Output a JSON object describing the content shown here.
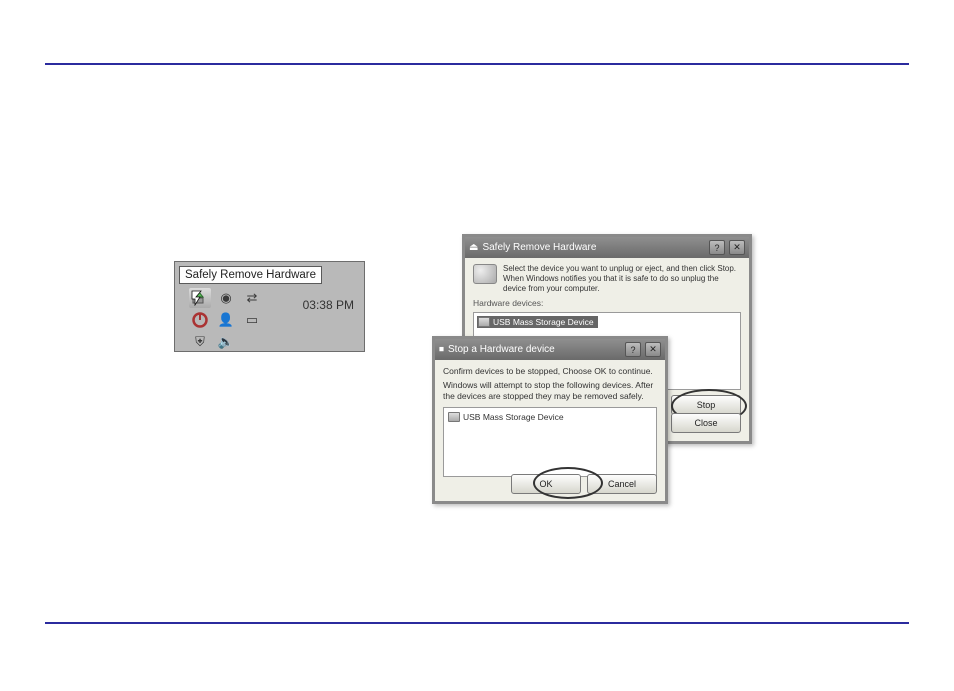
{
  "tooltip": "Safely Remove Hardware",
  "tray_time": "03:38 PM",
  "win1": {
    "title": "Safely Remove Hardware",
    "headline": "Select the device you want to unplug or eject, and then click Stop. When Windows notifies you that it is safe to do so unplug the device from your computer.",
    "list_label": "Hardware devices:",
    "item": "USB Mass Storage Device",
    "btn_stop": "Stop",
    "btn_close": "Close"
  },
  "win2": {
    "title": "Stop a Hardware device",
    "line1": "Confirm devices to be stopped, Choose OK to continue.",
    "line2": "Windows will attempt to stop the following devices. After the devices are stopped they may be removed safely.",
    "item": "USB Mass Storage Device",
    "btn_ok": "OK",
    "btn_cancel": "Cancel"
  }
}
